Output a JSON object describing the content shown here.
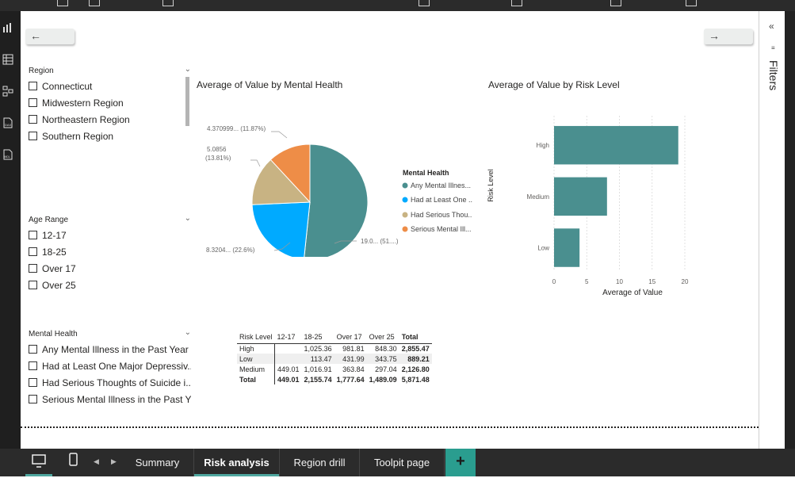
{
  "nav": {
    "back_icon": "←",
    "forward_icon": "→"
  },
  "slicers": {
    "region": {
      "title": "Region",
      "items": [
        "Connecticut",
        "Midwestern Region",
        "Northeastern Region",
        "Southern Region"
      ]
    },
    "age_range": {
      "title": "Age Range",
      "items": [
        "12-17",
        "18-25",
        "Over 17",
        "Over 25"
      ]
    },
    "mental_health": {
      "title": "Mental Health",
      "items": [
        "Any Mental Illness in the Past Year",
        "Had at Least One Major Depressiv...",
        "Had Serious Thoughts of Suicide i...",
        "Serious Mental Illness in the Past Y..."
      ]
    }
  },
  "pie": {
    "title": "Average of Value by Mental Health",
    "legend_title": "Mental Health",
    "colors": [
      "#4a8f8f",
      "#00aaff",
      "#c8b383",
      "#ee8d47"
    ],
    "legend": [
      "Any Mental Illnes...",
      "Had at Least One ...",
      "Had Serious Thou...",
      "Serious Mental Ill..."
    ],
    "labels": [
      "19.0... (51....)",
      "8.3204... (22.6%)",
      "5.0856",
      "(13.81%)",
      "4.370999... (11.87%)"
    ]
  },
  "bar": {
    "title": "Average of Value by Risk Level",
    "ylabel": "Risk Level",
    "xlabel": "Average of Value",
    "color": "#4a8f8f",
    "ticks": [
      "0",
      "5",
      "10",
      "15",
      "20"
    ]
  },
  "matrix": {
    "headers": [
      "Risk Level",
      "12-17",
      "18-25",
      "Over 17",
      "Over 25",
      "Total"
    ],
    "rows": [
      [
        "High",
        "",
        "1,025.36",
        "981.81",
        "848.30",
        "2,855.47"
      ],
      [
        "Low",
        "",
        "113.47",
        "431.99",
        "343.75",
        "889.21"
      ],
      [
        "Medium",
        "449.01",
        "1,016.91",
        "363.84",
        "297.04",
        "2,126.80"
      ],
      [
        "Total",
        "449.01",
        "2,155.74",
        "1,777.64",
        "1,489.09",
        "5,871.48"
      ]
    ]
  },
  "right_pane": {
    "filters_label": "Filters",
    "collapse_icon": "«"
  },
  "tabs": [
    "Summary",
    "Risk analysis",
    "Region drill",
    "Toolpit page"
  ],
  "active_tab": "Risk analysis",
  "add_tab_label": "+",
  "chart_data": [
    {
      "type": "pie",
      "title": "Average of Value by Mental Health",
      "legend_title": "Mental Health",
      "categories": [
        "Any Mental Illnes...",
        "Had at Least One ...",
        "Had Serious Thou...",
        "Serious Mental Ill..."
      ],
      "values": [
        19.0,
        8.3204,
        5.0856,
        4.370999
      ],
      "percents": [
        51.7,
        22.6,
        13.81,
        11.87
      ],
      "legend_position": "right"
    },
    {
      "type": "bar",
      "orientation": "horizontal",
      "title": "Average of Value by Risk Level",
      "categories": [
        "High",
        "Medium",
        "Low"
      ],
      "values": [
        19.0,
        8.1,
        3.9
      ],
      "xlabel": "Average of Value",
      "ylabel": "Risk Level",
      "xlim": [
        0,
        20
      ],
      "grid": true
    }
  ]
}
